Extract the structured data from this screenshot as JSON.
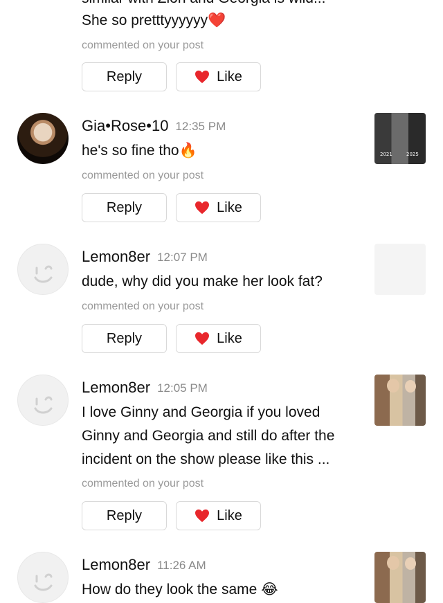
{
  "colors": {
    "like_heart": "#e8272c",
    "meta_text": "#9a9a9a",
    "border": "#d9d9d9"
  },
  "actions": {
    "reply_label": "Reply",
    "like_label": "Like"
  },
  "comments": [
    {
      "cut_top_text": "similar with Zion and Georgia is wild...",
      "text": "She so pretttyyyyyy❤️",
      "meta": "commented on your post"
    },
    {
      "user": "Gia•Rose•10",
      "time": "12:35 PM",
      "text": "he's so fine tho🔥",
      "meta": "commented on your post",
      "avatar": "user-photo-avatar",
      "thumb_labels": [
        "2021",
        "2025"
      ]
    },
    {
      "user": "Lemon8er",
      "time": "12:07 PM",
      "text": "dude, why did you make her look fat?",
      "meta": "commented on your post",
      "avatar": "default-smiley-avatar"
    },
    {
      "user": "Lemon8er",
      "time": "12:05 PM",
      "text_lines": [
        "I love Ginny and Georgia if you loved",
        "Ginny and Georgia and still do after the",
        "incident on the show please like this ..."
      ],
      "meta": "commented on your post",
      "avatar": "default-smiley-avatar"
    },
    {
      "user": "Lemon8er",
      "time": "11:26 AM",
      "text": "How do they look the same 😂",
      "avatar": "default-smiley-avatar"
    }
  ]
}
